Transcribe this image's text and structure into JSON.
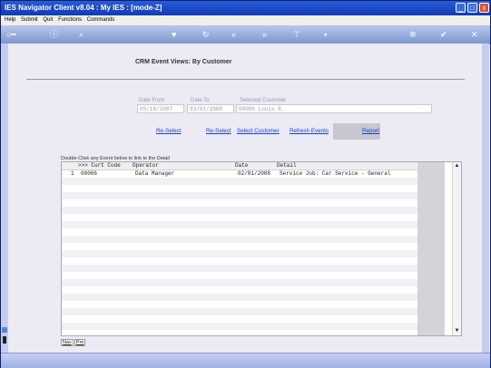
{
  "window": {
    "title": "IES Navigator Client v8.04 : My IES :     [mode-Z]",
    "controls": {
      "minimize": "_",
      "maximize": "□",
      "close": "x"
    }
  },
  "menu": [
    "Help",
    "Submit",
    "Quit",
    "Functions",
    "Commands"
  ],
  "toolbar": {
    "icons": [
      "key-icon",
      "info-icon",
      "search-icon",
      "heart-icon",
      "refresh-icon",
      "back-icon",
      "forward-icon",
      "filter-icon",
      "save-icon",
      "settings-icon",
      "check-icon",
      "close-icon"
    ]
  },
  "page": {
    "heading": "CRM Event Views: By Customer",
    "fields": [
      {
        "label": "Date From",
        "value": "05/10/2007"
      },
      {
        "label": "Date To",
        "value": "03/01/2008"
      },
      {
        "label": "Selected Customer",
        "value": "00006 Louis R."
      }
    ],
    "links": {
      "reselect1": "Re-Select",
      "reselect2": "Re-Select",
      "select_customer": "Select Customer",
      "refresh_events": "Refresh Events",
      "report": "Report"
    },
    "hint": "Double-Click any Event below to link to the Detail"
  },
  "grid": {
    "columns": [
      ">>> Curt Code",
      "Operator",
      "Date",
      "Detail"
    ],
    "rows": [
      {
        "num": "1",
        "code": "00006",
        "operator": "Data Manager",
        "date": "02/01/2008",
        "detail": "Service Job: Car Service - General"
      }
    ]
  },
  "tabs": [
    "Nav",
    "Pre"
  ],
  "colors": {
    "titlebar": "#0f3cb8",
    "link": "#1a3fd1",
    "content_bg": "#eceaf3"
  }
}
